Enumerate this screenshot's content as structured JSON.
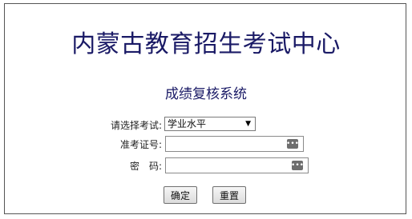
{
  "header": {
    "title": "内蒙古教育招生考试中心",
    "subtitle": "成绩复核系统"
  },
  "form": {
    "exam_label": "请选择考试:",
    "exam_selected": "学业水平",
    "ticket_label": "准考证号:",
    "ticket_value": "",
    "password_label": "密　码:",
    "password_value": ""
  },
  "buttons": {
    "confirm": "确定",
    "reset": "重置"
  },
  "icons": {
    "dropdown": "dropdown-arrow-icon",
    "password_manager": "password-manager-icon"
  }
}
